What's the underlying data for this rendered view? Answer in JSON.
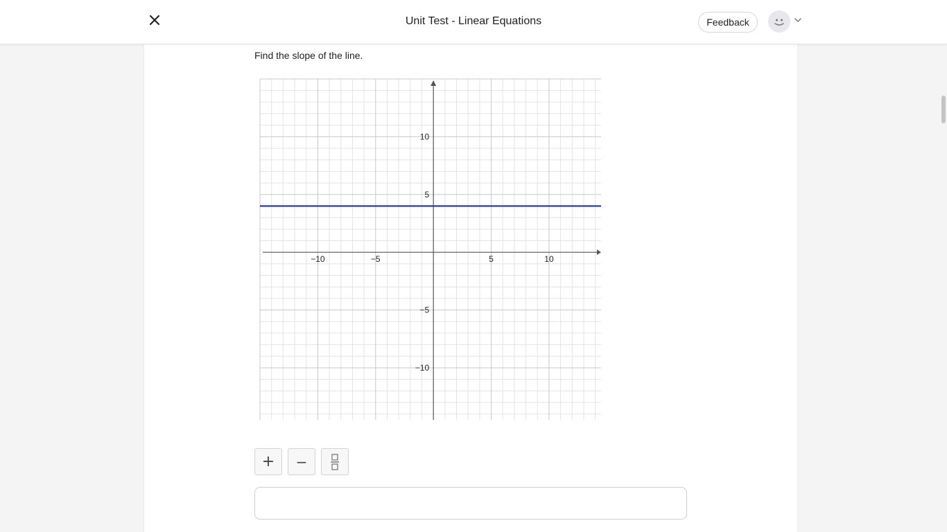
{
  "header": {
    "title": "Unit Test - Linear Equations",
    "feedback_label": "Feedback"
  },
  "question": {
    "prompt": "Find the slope of the line."
  },
  "chart_data": {
    "type": "line",
    "xlim": [
      -15,
      14.5
    ],
    "ylim": [
      -14.5,
      15
    ],
    "x_ticks": [
      -10,
      -5,
      5,
      10
    ],
    "y_ticks": [
      10,
      5,
      -5,
      -10
    ],
    "x_tick_labels": [
      "−10",
      "−5",
      "5",
      "10"
    ],
    "y_tick_labels": [
      "10",
      "5",
      "−5",
      "−10"
    ],
    "minor_grid_step": 1,
    "major_grid_step": 5,
    "grid": true,
    "series": [
      {
        "x": [
          -15,
          14.5
        ],
        "y": [
          4,
          4
        ],
        "color": "#1f2fb8"
      }
    ]
  },
  "toolbar": {
    "plus_symbol": "+",
    "minus_symbol": "−"
  },
  "colors": {
    "line": "#1f2fb8",
    "axis": "#555555",
    "grid_minor": "#e4e4e4",
    "grid_major": "#c8c8c8"
  },
  "icons": {
    "close": "close-icon",
    "avatar": "smiley-avatar-icon",
    "dropdown": "chevron-down-icon",
    "fraction": "fraction-icon"
  }
}
